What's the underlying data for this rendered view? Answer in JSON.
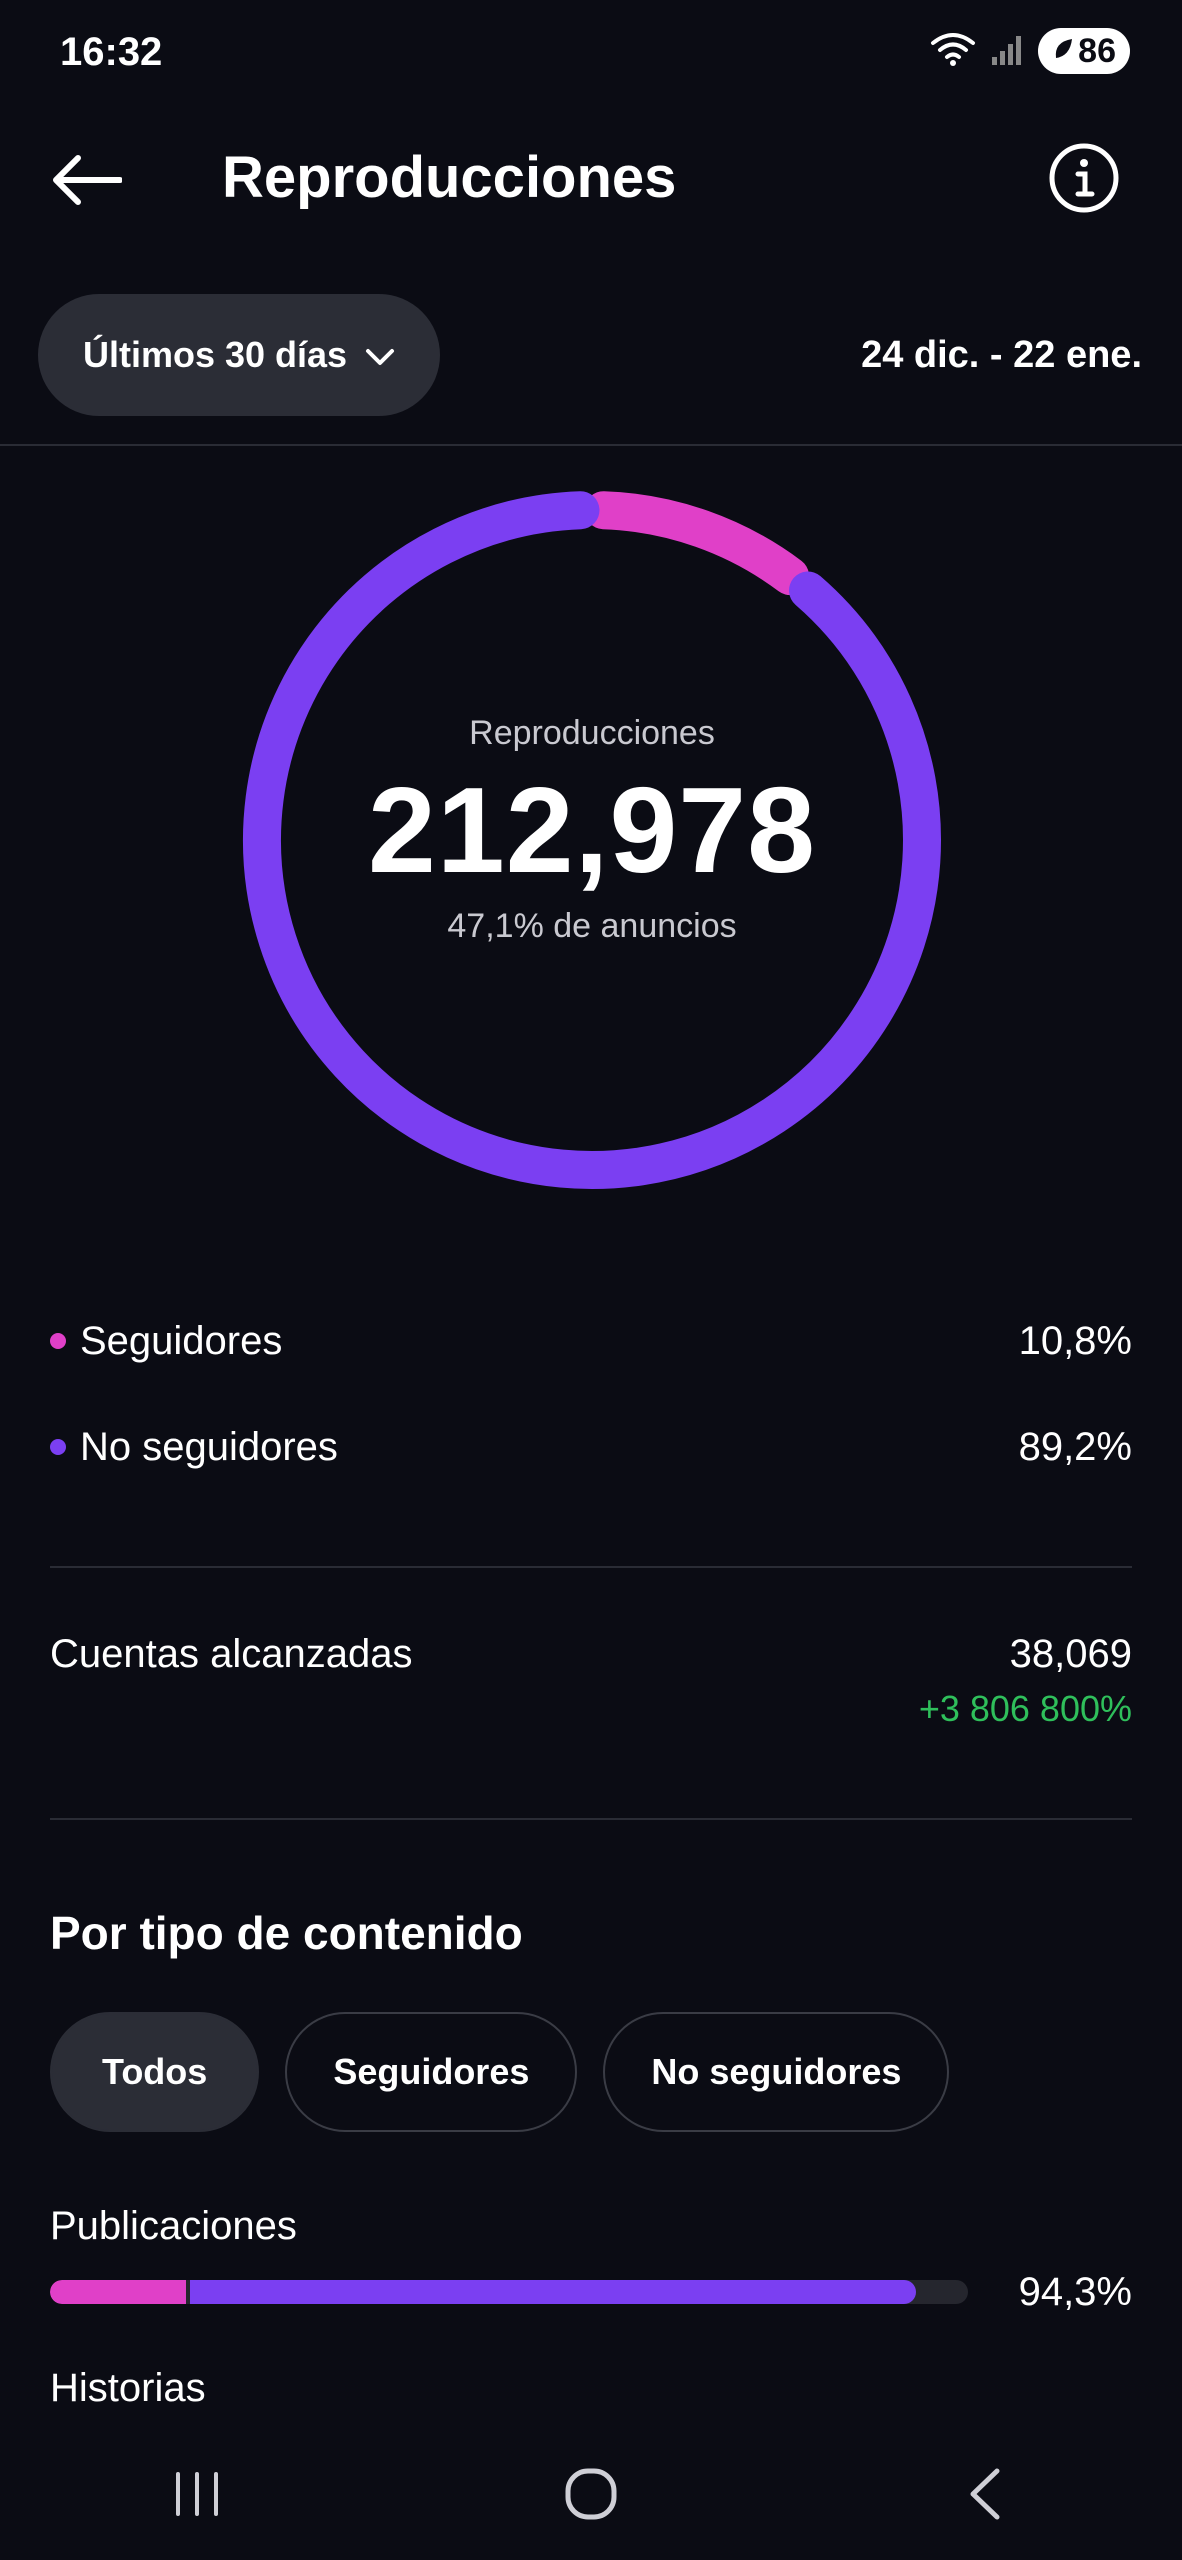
{
  "status_bar": {
    "time": "16:32",
    "battery": "86",
    "icons": [
      "wifi-icon",
      "signal-icon",
      "battery-saver-icon"
    ]
  },
  "header": {
    "title": "Reproducciones",
    "back_icon": "arrow-left-icon",
    "info_icon": "info-icon"
  },
  "filter": {
    "range_label": "Últimos 30 días",
    "date_range": "24 dic. - 22 ene."
  },
  "summary": {
    "label": "Reproducciones",
    "value": "212,978",
    "ads_note": "47,1% de anuncios"
  },
  "chart_data": {
    "type": "pie",
    "categories": [
      "Seguidores",
      "No seguidores"
    ],
    "values": [
      10.8,
      89.2
    ],
    "colors": [
      "#e040c8",
      "#7b3ff2"
    ],
    "title": "Reproducciones"
  },
  "legend": [
    {
      "label": "Seguidores",
      "value": "10,8%",
      "color": "#e040c8"
    },
    {
      "label": "No seguidores",
      "value": "89,2%",
      "color": "#7b3ff2"
    }
  ],
  "accounts": {
    "label": "Cuentas alcanzadas",
    "value": "38,069",
    "change": "+3 806 800%",
    "change_color": "#2fbf5b"
  },
  "content_type": {
    "title": "Por tipo de contenido",
    "chips": [
      "Todos",
      "Seguidores",
      "No seguidores"
    ],
    "selected": "Todos",
    "rows": [
      {
        "label": "Publicaciones",
        "percent": "94,3%",
        "followers_fraction": 0.108,
        "total_fraction": 0.943
      },
      {
        "label": "Historias"
      }
    ]
  },
  "colors": {
    "background": "#0b0c14",
    "accent_pink": "#e040c8",
    "accent_purple": "#7b3ff2",
    "positive": "#2fbf5b"
  },
  "nav_bar": {
    "icons": [
      "recent-apps-icon",
      "home-icon",
      "back-icon"
    ]
  }
}
